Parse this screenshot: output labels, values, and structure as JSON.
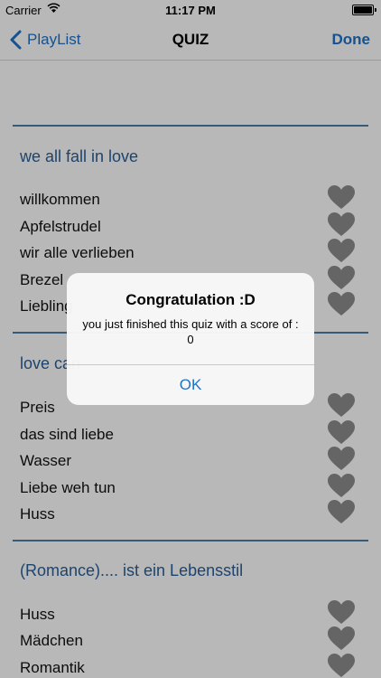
{
  "status": {
    "carrier": "Carrier",
    "time": "11:17 PM"
  },
  "nav": {
    "back_label": "PlayList",
    "title": "QUIZ",
    "done_label": "Done"
  },
  "sections": [
    {
      "title": "we all fall in love",
      "items": [
        "willkommen",
        "Apfelstrudel",
        "wir alle verlieben",
        "Brezel",
        "Liebling"
      ]
    },
    {
      "title": "love can",
      "items": [
        "Preis",
        "das sind liebe",
        "Wasser",
        "Liebe weh tun",
        "Huss"
      ]
    },
    {
      "title": "(Romance).... ist ein Lebensstil",
      "items": [
        "Huss",
        "Mädchen",
        "Romantik"
      ]
    }
  ],
  "alert": {
    "title": "Congratulation :D",
    "message": "you just finished this quiz with a score of : 0",
    "ok_label": "OK"
  },
  "colors": {
    "accent": "#1e72c8",
    "header_text": "#2a5f98",
    "separator": "#4d7fa6",
    "heart": "#8c8c8c"
  }
}
